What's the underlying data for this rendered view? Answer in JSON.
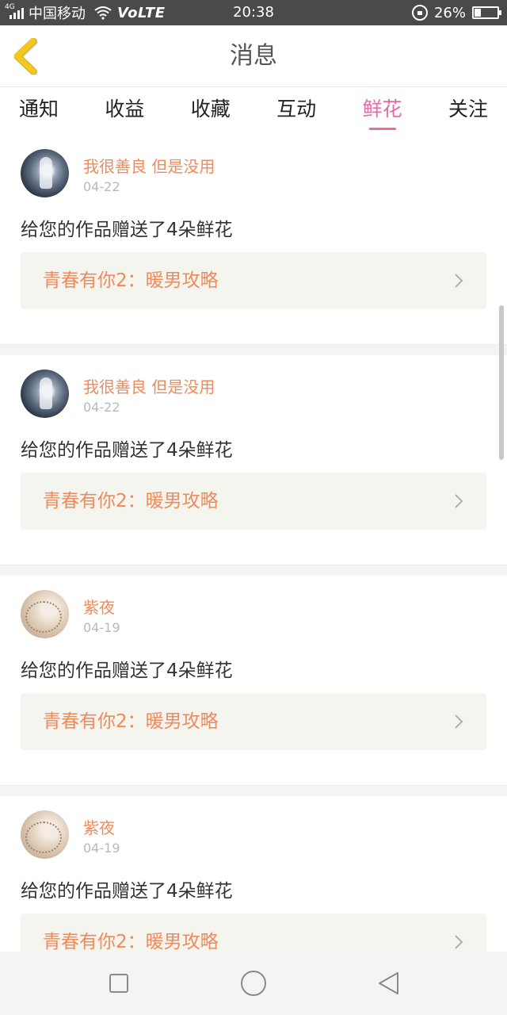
{
  "status_bar": {
    "network_tag": "4G",
    "carrier": "中国移动",
    "volte": "VoLTE",
    "time": "20:38",
    "battery": "26%",
    "battery_level": 0.26
  },
  "header": {
    "title": "消息"
  },
  "tabs": [
    {
      "label": "通知",
      "active": false
    },
    {
      "label": "收益",
      "active": false
    },
    {
      "label": "收藏",
      "active": false
    },
    {
      "label": "互动",
      "active": false
    },
    {
      "label": "鲜花",
      "active": true
    },
    {
      "label": "关注",
      "active": false
    }
  ],
  "messages": [
    {
      "user": "我很善良 但是没用",
      "date": "04-22",
      "text": "给您的作品赠送了4朵鲜花",
      "work": "青春有你2：暖男攻略"
    },
    {
      "user": "我很善良 但是没用",
      "date": "04-22",
      "text": "给您的作品赠送了4朵鲜花",
      "work": "青春有你2：暖男攻略"
    },
    {
      "user": "紫夜",
      "date": "04-19",
      "text": "给您的作品赠送了4朵鲜花",
      "work": "青春有你2：暖男攻略"
    },
    {
      "user": "紫夜",
      "date": "04-19",
      "text": "给您的作品赠送了4朵鲜花",
      "work": "青春有你2：暖男攻略"
    }
  ],
  "colors": {
    "accent_pink": "#e86aa7",
    "name_orange": "#ef8a5a",
    "back_yellow": "#f2c21b"
  }
}
